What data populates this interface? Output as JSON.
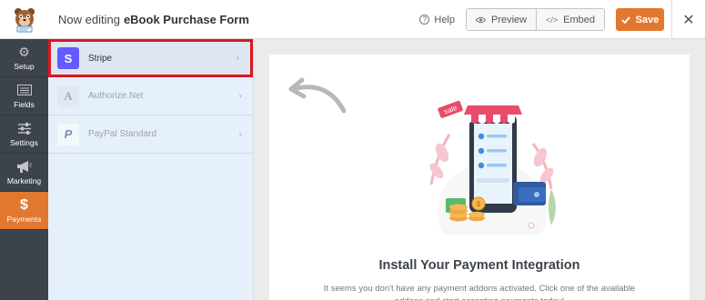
{
  "header": {
    "prefix": "Now editing",
    "form_name": "eBook Purchase Form",
    "help_label": "Help",
    "preview_label": "Preview",
    "embed_label": "Embed",
    "save_label": "Save",
    "close_icon": "close-icon"
  },
  "sidebar": {
    "items": [
      {
        "label": "Setup",
        "icon": "gear-icon"
      },
      {
        "label": "Fields",
        "icon": "list-icon"
      },
      {
        "label": "Settings",
        "icon": "sliders-icon"
      },
      {
        "label": "Marketing",
        "icon": "megaphone-icon"
      },
      {
        "label": "Payments",
        "icon": "dollar-icon",
        "active": true
      }
    ]
  },
  "payments": {
    "items": [
      {
        "name": "Stripe",
        "logo_letter": "S",
        "logo_color": "#635bff",
        "selected": true
      },
      {
        "name": "Authorize.Net",
        "logo_letter": "A",
        "logo_color": "#8a96a3"
      },
      {
        "name": "PayPal Standard",
        "logo_letter": "P",
        "logo_color": "#253b80"
      }
    ]
  },
  "main": {
    "sale_tag": "sale",
    "title": "Install Your Payment Integration",
    "text": "It seems you don't have any payment addons activated. Click one of the available addons and start accepting payments today!"
  },
  "colors": {
    "accent": "#e27730",
    "sidebar": "#3c434a",
    "panel": "#e6f0fa",
    "highlight": "#e0141e"
  }
}
